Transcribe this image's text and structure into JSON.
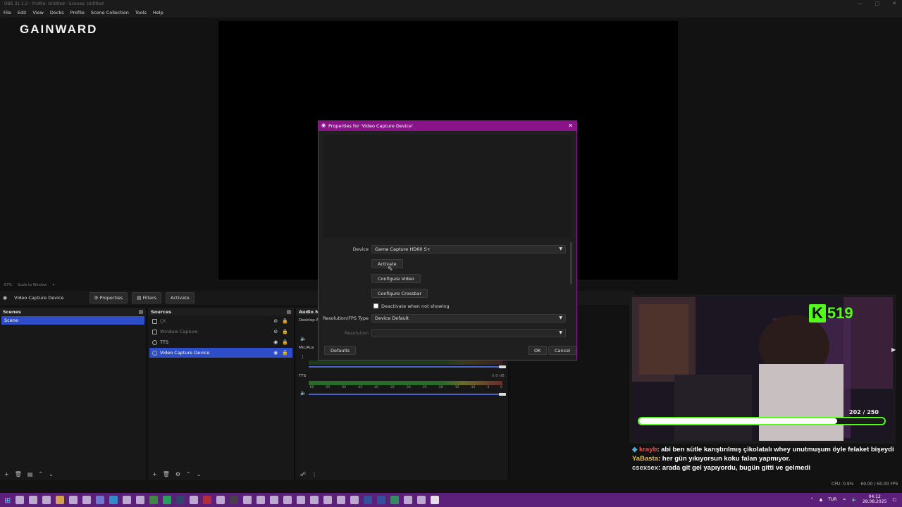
{
  "window": {
    "title": "OBS 31.1.2 - Profile: Untitled - Scenes: Untitled"
  },
  "menu": [
    "File",
    "Edit",
    "View",
    "Docks",
    "Profile",
    "Scene Collection",
    "Tools",
    "Help"
  ],
  "logo": "GAINWARD",
  "zoom": {
    "level": "67%",
    "mode": "Scale to Window"
  },
  "context_bar": {
    "source": "Video Capture Device",
    "properties": "Properties",
    "filters": "Filters",
    "activate": "Activate"
  },
  "scenes": {
    "title": "Scenes",
    "items": [
      "Scene"
    ]
  },
  "sources": {
    "title": "Sources",
    "items": [
      {
        "name": "ÇK",
        "dim": true
      },
      {
        "name": "Window Capture",
        "dim": true
      },
      {
        "name": "TTS",
        "dim": false
      },
      {
        "name": "Video Capture Device",
        "dim": false,
        "selected": true
      }
    ]
  },
  "audio": {
    "title": "Audio Mi",
    "tracks": [
      {
        "name": "Desktop A",
        "db": ""
      },
      {
        "name": "Mic/Aux",
        "db": ""
      },
      {
        "name": "TTS",
        "db": "0.0 dB"
      }
    ],
    "ticks": [
      "-60",
      "-55",
      "-50",
      "-45",
      "-40",
      "-35",
      "-30",
      "-25",
      "-20",
      "-15",
      "-10",
      "-5",
      "0"
    ]
  },
  "dialog": {
    "title": "Properties for 'Video Capture Device'",
    "device_label": "Device",
    "device_value": "Game Capture HD60 S+",
    "activate": "Activate",
    "configure_video": "Configure Video",
    "configure_crossbar": "Configure Crossbar",
    "deactivate_label": "Deactivate when not showing",
    "fps_label": "Resolution/FPS Type",
    "fps_value": "Device Default",
    "resolution_label": "Resolution",
    "resolution_value": "",
    "defaults": "Defaults",
    "ok": "OK",
    "cancel": "Cancel"
  },
  "stream_overlay": {
    "kick_count": "519",
    "goal_text": "202 / 250",
    "goal_fraction": 0.808
  },
  "chat": [
    {
      "user": "krayb",
      "msg": ": abi ben sütle karıştırılmış çikolatalı whey unutmuşum öyle felaket bişeydi",
      "color": "r"
    },
    {
      "user": "YaBasta",
      "msg": ": her gün yıkıyorsun koku falan yapmıyor.",
      "color": "y"
    },
    {
      "user": "csexsex",
      "msg": ": arada git gel yapıyordu, bugün gitti ve gelmedi",
      "color": "w"
    }
  ],
  "status": {
    "cpu": "CPU: 0.9%",
    "fps": "60.00 / 60.00 FPS"
  },
  "taskbar": {
    "lang": "TUR",
    "time": "04:12",
    "date": "28.08.2025"
  }
}
